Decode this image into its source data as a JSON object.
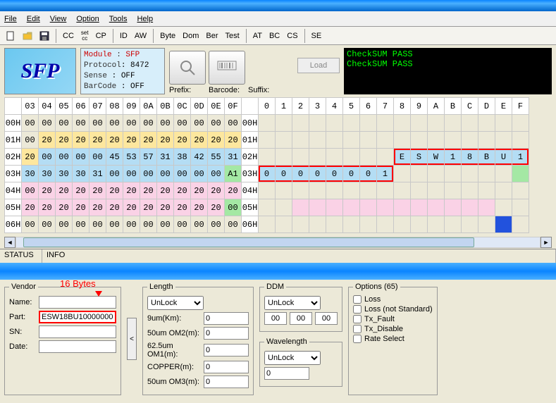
{
  "menu": [
    "File",
    "Edit",
    "View",
    "Option",
    "Tools",
    "Help"
  ],
  "toolbar": {
    "cc": "CC",
    "setcc_top": "set",
    "setcc_bot": "cc",
    "cp": "CP",
    "id": "ID",
    "aw": "AW",
    "byte": "Byte",
    "dom": "Dom",
    "ber": "Ber",
    "test": "Test",
    "at": "AT",
    "bc": "BC",
    "cs": "CS",
    "se": "SE"
  },
  "logo": "SFP",
  "module": {
    "k_module": "Module",
    "k_protocol": "Protocol",
    "k_sense": "Sense",
    "k_barcode": "BarCode",
    "v_module": "SFP",
    "v_protocol": "8472",
    "v_sense": "OFF",
    "v_barcode": "OFF"
  },
  "prefix": {
    "prefix_lbl": "Prefix:",
    "barcode_lbl": "Barcode:",
    "suffix_lbl": "Suffix:",
    "load": "Load"
  },
  "console": [
    "CheckSUM PASS",
    "CheckSUM PASS"
  ],
  "hex": {
    "cols_hex": [
      "03",
      "04",
      "05",
      "06",
      "07",
      "08",
      "09",
      "0A",
      "0B",
      "0C",
      "0D",
      "0E",
      "0F"
    ],
    "cols_ascii": [
      "0",
      "1",
      "2",
      "3",
      "4",
      "5",
      "6",
      "7",
      "8",
      "9",
      "A",
      "B",
      "C",
      "D",
      "E",
      "F"
    ],
    "rows": [
      {
        "addr": "00H",
        "r2": "00H",
        "hex": [
          "00",
          "00",
          "00",
          "00",
          "00",
          "00",
          "00",
          "00",
          "00",
          "00",
          "00",
          "00",
          "00"
        ],
        "asc": [
          "",
          "",
          "",
          "",
          "",
          "",
          "",
          "",
          "",
          "",
          "",
          "",
          "",
          "",
          "",
          ""
        ]
      },
      {
        "addr": "01H",
        "r2": "01H",
        "hex": [
          "00",
          "20",
          "20",
          "20",
          "20",
          "20",
          "20",
          "20",
          "20",
          "20",
          "20",
          "20",
          "20"
        ],
        "asc": [
          "",
          "",
          "",
          "",
          "",
          "",
          "",
          "",
          "",
          "",
          "",
          "",
          "",
          "",
          "",
          ""
        ]
      },
      {
        "addr": "02H",
        "r2": "02H",
        "hex": [
          "20",
          "00",
          "00",
          "00",
          "00",
          "45",
          "53",
          "57",
          "31",
          "38",
          "42",
          "55",
          "31"
        ],
        "asc": [
          "",
          "",
          "",
          "",
          "",
          "",
          "",
          "",
          "E",
          "S",
          "W",
          "1",
          "8",
          "B",
          "U",
          "1"
        ]
      },
      {
        "addr": "03H",
        "r2": "03H",
        "hex": [
          "30",
          "30",
          "30",
          "30",
          "31",
          "00",
          "00",
          "00",
          "00",
          "00",
          "00",
          "00",
          "A1"
        ],
        "asc": [
          "0",
          "0",
          "0",
          "0",
          "0",
          "0",
          "0",
          "1",
          "",
          "",
          "",
          "",
          "",
          "",
          "",
          ""
        ]
      },
      {
        "addr": "04H",
        "r2": "04H",
        "hex": [
          "00",
          "20",
          "20",
          "20",
          "20",
          "20",
          "20",
          "20",
          "20",
          "20",
          "20",
          "20",
          "20"
        ],
        "asc": [
          "",
          "",
          "",
          "",
          "",
          "",
          "",
          "",
          "",
          "",
          "",
          "",
          "",
          "",
          "",
          ""
        ]
      },
      {
        "addr": "05H",
        "r2": "05H",
        "hex": [
          "20",
          "20",
          "20",
          "20",
          "20",
          "20",
          "20",
          "20",
          "20",
          "20",
          "20",
          "20",
          "00"
        ],
        "asc": [
          "",
          "",
          "",
          "",
          "",
          "",
          "",
          "",
          "",
          "",
          "",
          "",
          "",
          "",
          "",
          ""
        ]
      },
      {
        "addr": "06H",
        "r2": "06H",
        "hex": [
          "00",
          "00",
          "00",
          "00",
          "00",
          "00",
          "00",
          "00",
          "00",
          "00",
          "00",
          "00",
          "00"
        ],
        "asc": [
          "",
          "",
          "",
          "",
          "",
          "",
          "",
          "",
          "",
          "",
          "",
          "",
          "",
          "",
          "",
          ""
        ]
      }
    ]
  },
  "status": {
    "status": "STATUS",
    "info": "INFO"
  },
  "annotation": "16 Bytes",
  "vendor": {
    "legend": "Vendor",
    "name_lbl": "Name:",
    "name": "",
    "part_lbl": "Part:",
    "part": "ESW18BU100000001",
    "sn_lbl": "SN:",
    "sn": "",
    "date_lbl": "Date:",
    "date": ""
  },
  "length": {
    "legend": "Length",
    "select": "UnLock",
    "r1": "9um(Km):",
    "r2": "50um OM2(m):",
    "r3": "62.5um OM1(m):",
    "r4": "COPPER(m):",
    "r5": "50um OM3(m):",
    "v": "0"
  },
  "ddm": {
    "legend": "DDM",
    "select": "UnLock",
    "v": "00"
  },
  "wavelength": {
    "legend": "Wavelength",
    "select": "UnLock",
    "v": "0"
  },
  "options": {
    "legend": "Options (65)",
    "o1": "Loss",
    "o2": "Loss (not Standard)",
    "o3": "Tx_Fault",
    "o4": "Tx_Disable",
    "o5": "Rate Select"
  }
}
